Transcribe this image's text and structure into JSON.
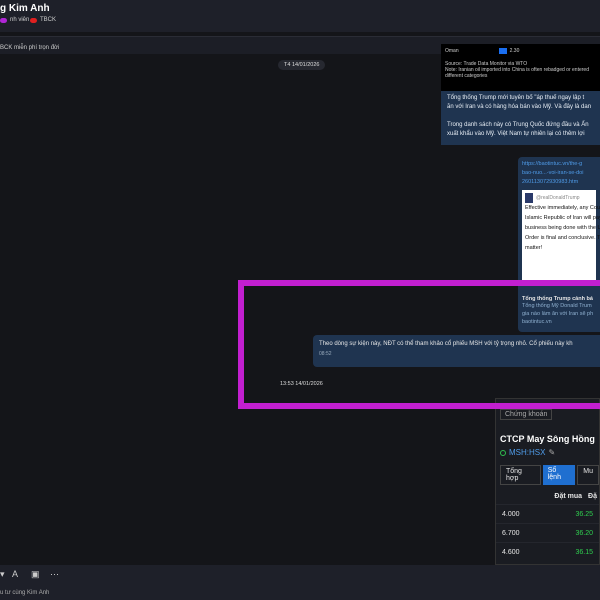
{
  "header": {
    "title": "g Kim Anh",
    "tags": [
      {
        "label": "nh viên",
        "color": "#b026d6"
      },
      {
        "label": "TBCK",
        "color": "#e02020"
      }
    ]
  },
  "pinned": {
    "text": "BCK miễn phí trọn đời"
  },
  "messages": {
    "date1": "T4 14/01/2026",
    "image": {
      "row_label": "Oman",
      "row_value": "2.30",
      "source": "Source: Trade Data Monitor via WTO",
      "note": "Note: Iranian oil imported into China is often rebadged or entered",
      "note2": "different categories"
    },
    "bubble1": {
      "p1a": "Tổng thống Trump mới tuyên bố \"áp thuế ngay lập t",
      "p1b": "ăn với Iran và có hàng hóa bán vào Mỹ. Và đây là dan",
      "p2a": "Trong danh sách này có Trung Quốc đứng đầu và Ấn",
      "p2b": "xuất khẩu vào Mỹ. Việt Nam tự nhiên lại có thêm lợi"
    },
    "link": {
      "url1": "https://baotintuc.vn/the-g",
      "url2": "bao-nuo...-voi-iran-se-doi",
      "url3": "260113072930983.htm",
      "handle": "@realDonaldTrump",
      "tweet": [
        "Effective immediately, any Cou",
        "Islamic Republic of Iran will pay",
        "business being done with the U",
        "Order is final and conclusive. T",
        "matter!"
      ],
      "title": "Tổng thống Trump cảnh bá",
      "desc1": "Tổng thống Mỹ Donald Trum",
      "desc2": "gia nào làm ăn với Iran sẽ ph",
      "domain": "baotintuc.vn"
    },
    "msg": {
      "text": "Theo dòng sự kiện này, NĐT có thể tham khảo cổ phiếu MSH với tỷ trọng nhỏ. Cổ phiếu này kh",
      "time": "08:52"
    },
    "date2": "13:53 14/01/2026"
  },
  "stock": {
    "dropdown": "Chứng khoán",
    "company": "CTCP May Sông Hồng",
    "ticker": "MSH:HSX",
    "tabs": [
      "Tổng hợp",
      "Sổ lệnh",
      "Mu"
    ],
    "col_header": "Đặt mua",
    "col_header2": "Đặ",
    "rows": [
      {
        "vol": "4.000",
        "price": "36.25"
      },
      {
        "vol": "6.700",
        "price": "36.20"
      },
      {
        "vol": "4.600",
        "price": "36.15"
      }
    ]
  },
  "composer": {
    "placeholder": "u tư cùng Kim Anh"
  }
}
